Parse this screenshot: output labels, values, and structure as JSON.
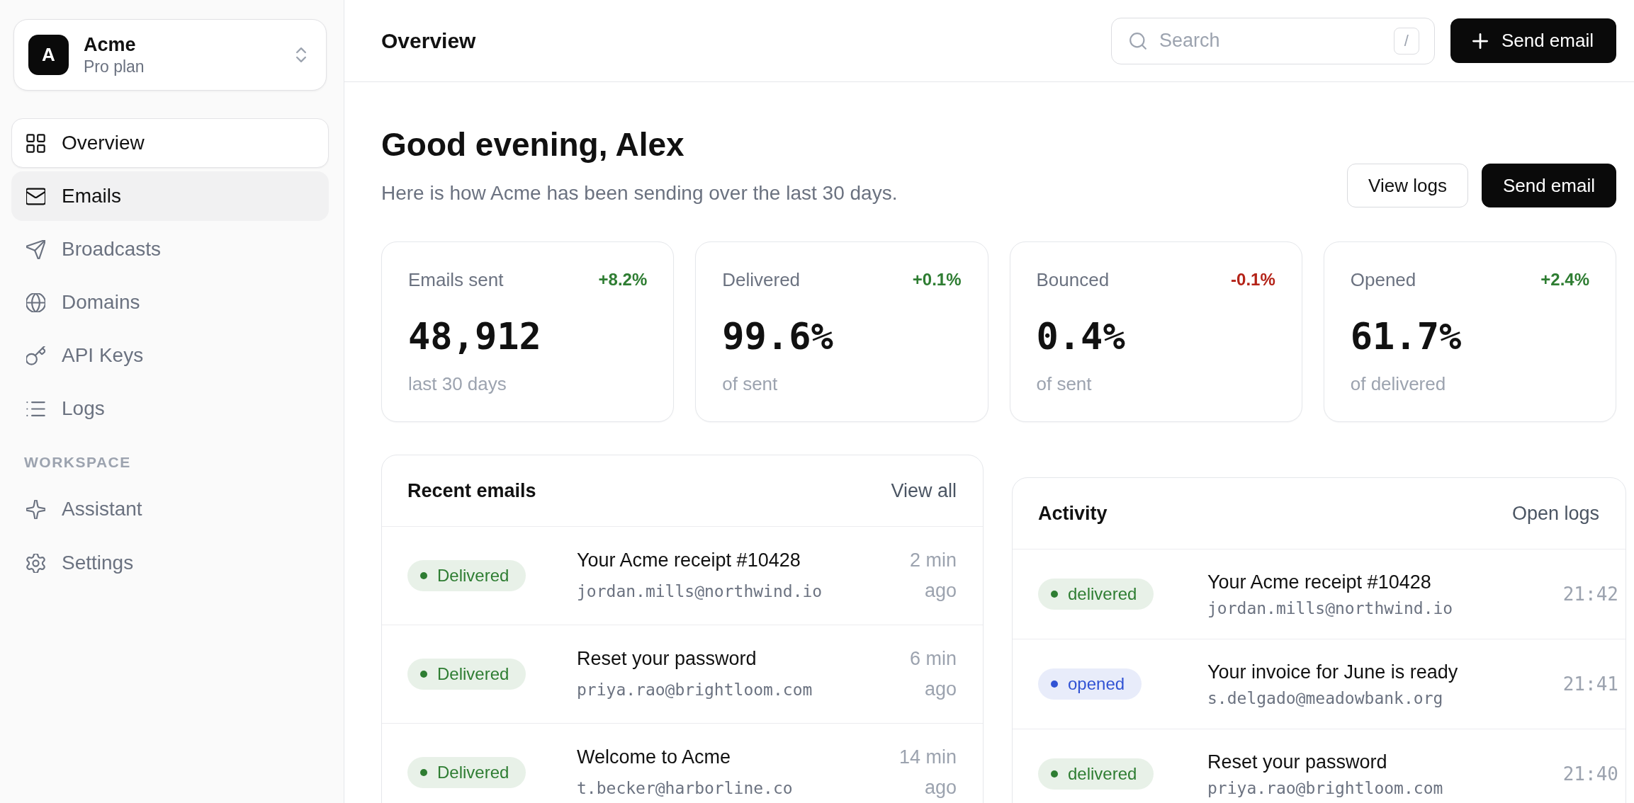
{
  "sidebar": {
    "workspace": {
      "initial": "A",
      "name": "Acme",
      "plan": "Pro plan"
    },
    "nav": [
      {
        "label": "Overview",
        "selected": true,
        "hovered": false
      },
      {
        "label": "Emails",
        "selected": false,
        "hovered": true
      },
      {
        "label": "Broadcasts",
        "selected": false,
        "hovered": false
      },
      {
        "label": "Domains",
        "selected": false,
        "hovered": false
      },
      {
        "label": "API Keys",
        "selected": false,
        "hovered": false
      },
      {
        "label": "Logs",
        "selected": false,
        "hovered": false
      }
    ],
    "section": {
      "title": "WORKSPACE",
      "items": [
        {
          "label": "Assistant",
          "selected": false,
          "hovered": false
        },
        {
          "label": "Settings",
          "selected": false,
          "hovered": false
        }
      ]
    }
  },
  "header": {
    "title": "Overview",
    "search": {
      "placeholder": "Search",
      "shortcut": "/"
    },
    "button": "Send email"
  },
  "greeting": {
    "title": "Good evening, Alex",
    "subtitle": "Here is how Acme has been sending over the last 30 days.",
    "buttons": [
      {
        "label": "View logs",
        "kind": "secondary"
      },
      {
        "label": "Send email",
        "kind": "primary"
      }
    ]
  },
  "stats": [
    {
      "label": "Emails sent",
      "change": "+8.2%",
      "color": "#2e7d32",
      "value": "48,912",
      "note": "last 30 days"
    },
    {
      "label": "Delivered",
      "change": "+0.1%",
      "color": "#2e7d32",
      "value": "99.6%",
      "note": "of sent"
    },
    {
      "label": "Bounced",
      "change": "-0.1%",
      "color": "#b42318",
      "value": "0.4%",
      "note": "of sent"
    },
    {
      "label": "Opened",
      "change": "+2.4%",
      "color": "#2e7d32",
      "value": "61.7%",
      "note": "of delivered"
    }
  ],
  "recent_emails": {
    "title": "Recent emails",
    "link": "View all",
    "rows": [
      {
        "status": "Delivered",
        "color": "#2e7d32",
        "subject": "Your Acme receipt #10428",
        "email": "jordan.mills@northwind.io",
        "time": "2 min ago"
      },
      {
        "status": "Delivered",
        "color": "#2e7d32",
        "subject": "Reset your password",
        "email": "priya.rao@brightloom.com",
        "time": "6 min ago"
      },
      {
        "status": "Delivered",
        "color": "#2e7d32",
        "subject": "Welcome to Acme",
        "email": "t.becker@harborline.co",
        "time": "14 min ago"
      }
    ]
  },
  "activity": {
    "title": "Activity",
    "link": "Open logs",
    "rows": [
      {
        "status": "delivered",
        "color": "#2e7d32",
        "subject": "Your Acme receipt #10428",
        "email": "jordan.mills@northwind.io",
        "time": "21:42"
      },
      {
        "status": "opened",
        "color": "#3153d4",
        "subject": "Your invoice for June is ready",
        "email": "s.delgado@meadowbank.org",
        "time": "21:41"
      },
      {
        "status": "delivered",
        "color": "#2e7d32",
        "subject": "Reset your password",
        "email": "priya.rao@brightloom.com",
        "time": "21:40"
      }
    ]
  }
}
